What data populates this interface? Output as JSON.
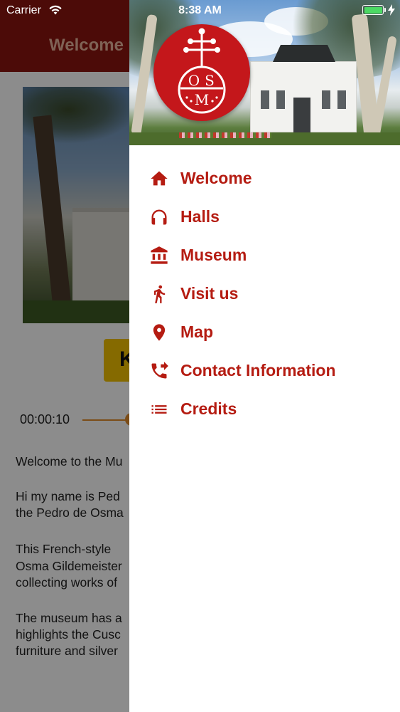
{
  "status_bar": {
    "carrier": "Carrier",
    "time": "8:38 AM"
  },
  "background": {
    "header_title": "Welcome",
    "play_button_glyph": "K",
    "audio_time": "00:00:10",
    "paragraphs": [
      "Welcome to the Mu",
      "Hi my name is Ped",
      "the Pedro de Osma",
      "This French-style",
      "Osma Gildemeister",
      "collecting works of",
      "The museum has a",
      "highlights the Cusc",
      "furniture and silver"
    ]
  },
  "drawer": {
    "logo_letters": [
      "O",
      "S",
      "M"
    ],
    "menu": [
      {
        "label": "Welcome",
        "icon": "home-icon"
      },
      {
        "label": "Halls",
        "icon": "headphones-icon"
      },
      {
        "label": "Museum",
        "icon": "museum-icon"
      },
      {
        "label": "Visit us",
        "icon": "walking-person-icon"
      },
      {
        "label": "Map",
        "icon": "map-pin-icon"
      },
      {
        "label": "Contact Information",
        "icon": "phone-forward-icon"
      },
      {
        "label": "Credits",
        "icon": "list-icon"
      }
    ]
  },
  "colors": {
    "brand_red": "#b51c12",
    "header_dark_red": "#8a1410",
    "logo_red": "#c4171b",
    "accent_yellow": "#f2c100",
    "slider_orange": "#e08b2a",
    "battery_green": "#4cd964"
  }
}
